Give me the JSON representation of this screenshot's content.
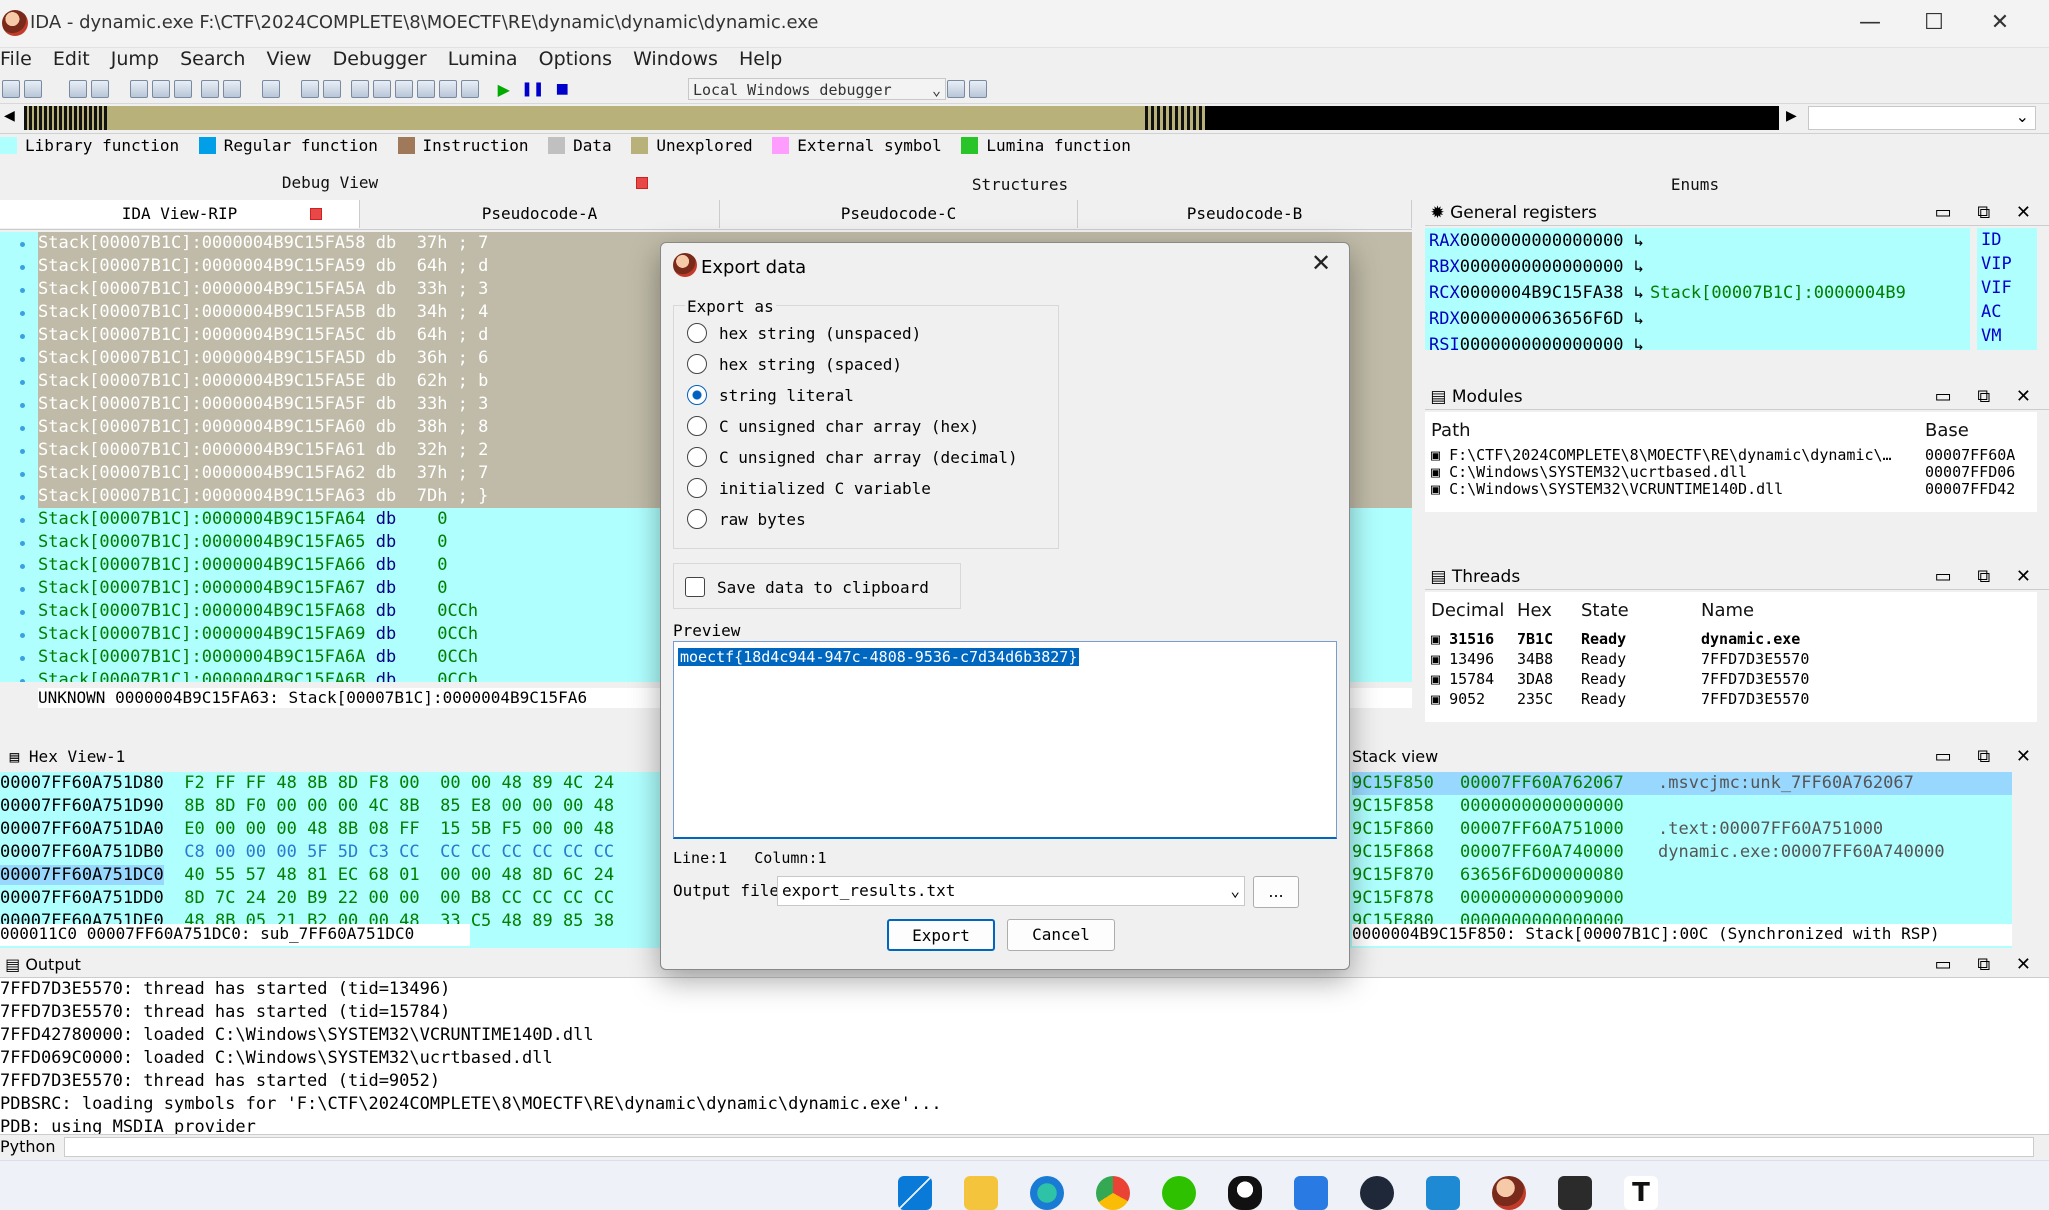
{
  "window": {
    "title": "IDA - dynamic.exe F:\\CTF\\2024COMPLETE\\8\\MOECTF\\RE\\dynamic\\dynamic\\dynamic.exe",
    "min": "—",
    "max": "☐",
    "close": "✕"
  },
  "menu": [
    "File",
    "Edit",
    "Jump",
    "Search",
    "View",
    "Debugger",
    "Lumina",
    "Options",
    "Windows",
    "Help"
  ],
  "toolbar": {
    "debugger": "Local Windows debugger"
  },
  "legend": [
    {
      "label": "Library function",
      "color": "#b0ffff"
    },
    {
      "label": "Regular function",
      "color": "#009fe8"
    },
    {
      "label": "Instruction",
      "color": "#a0785a"
    },
    {
      "label": "Data",
      "color": "#c0c0c0"
    },
    {
      "label": "Unexplored",
      "color": "#b8b27a"
    },
    {
      "label": "External symbol",
      "color": "#ff9cff"
    },
    {
      "label": "Lumina function",
      "color": "#28c428"
    }
  ],
  "panes": {
    "debug_view": "Debug View",
    "structures": "Structures",
    "enums": "Enums"
  },
  "tabs": [
    "IDA View-RIP",
    "Pseudocode-A",
    "Pseudocode-C",
    "Pseudocode-B"
  ],
  "disasm": [
    {
      "addr": "Stack[00007B1C]:0000004B9C15FA58",
      "op": "db",
      "arg": "37h ; 7",
      "gray": true
    },
    {
      "addr": "Stack[00007B1C]:0000004B9C15FA59",
      "op": "db",
      "arg": "64h ; d",
      "gray": true
    },
    {
      "addr": "Stack[00007B1C]:0000004B9C15FA5A",
      "op": "db",
      "arg": "33h ; 3",
      "gray": true
    },
    {
      "addr": "Stack[00007B1C]:0000004B9C15FA5B",
      "op": "db",
      "arg": "34h ; 4",
      "gray": true
    },
    {
      "addr": "Stack[00007B1C]:0000004B9C15FA5C",
      "op": "db",
      "arg": "64h ; d",
      "gray": true
    },
    {
      "addr": "Stack[00007B1C]:0000004B9C15FA5D",
      "op": "db",
      "arg": "36h ; 6",
      "gray": true
    },
    {
      "addr": "Stack[00007B1C]:0000004B9C15FA5E",
      "op": "db",
      "arg": "62h ; b",
      "gray": true
    },
    {
      "addr": "Stack[00007B1C]:0000004B9C15FA5F",
      "op": "db",
      "arg": "33h ; 3",
      "gray": true
    },
    {
      "addr": "Stack[00007B1C]:0000004B9C15FA60",
      "op": "db",
      "arg": "38h ; 8",
      "gray": true
    },
    {
      "addr": "Stack[00007B1C]:0000004B9C15FA61",
      "op": "db",
      "arg": "32h ; 2",
      "gray": true
    },
    {
      "addr": "Stack[00007B1C]:0000004B9C15FA62",
      "op": "db",
      "arg": "37h ; 7",
      "gray": true
    },
    {
      "addr": "Stack[00007B1C]:0000004B9C15FA63",
      "op": "db",
      "arg": "7Dh ; }",
      "gray": true
    },
    {
      "addr": "Stack[00007B1C]:0000004B9C15FA64",
      "op": "db",
      "arg": "0",
      "gray": false
    },
    {
      "addr": "Stack[00007B1C]:0000004B9C15FA65",
      "op": "db",
      "arg": "0",
      "gray": false
    },
    {
      "addr": "Stack[00007B1C]:0000004B9C15FA66",
      "op": "db",
      "arg": "0",
      "gray": false
    },
    {
      "addr": "Stack[00007B1C]:0000004B9C15FA67",
      "op": "db",
      "arg": "0",
      "gray": false
    },
    {
      "addr": "Stack[00007B1C]:0000004B9C15FA68",
      "op": "db",
      "arg": "0CCh",
      "gray": false
    },
    {
      "addr": "Stack[00007B1C]:0000004B9C15FA69",
      "op": "db",
      "arg": "0CCh",
      "gray": false
    },
    {
      "addr": "Stack[00007B1C]:0000004B9C15FA6A",
      "op": "db",
      "arg": "0CCh",
      "gray": false
    },
    {
      "addr": "Stack[00007B1C]:0000004B9C15FA6B",
      "op": "db",
      "arg": "0CCh",
      "gray": false
    }
  ],
  "disasm_status": "UNKNOWN 0000004B9C15FA63: Stack[00007B1C]:0000004B9C15FA6",
  "registers": {
    "title": "General registers",
    "rows": [
      {
        "name": "RAX",
        "val": "0000000000000000",
        "extra": ""
      },
      {
        "name": "RBX",
        "val": "0000000000000000",
        "extra": ""
      },
      {
        "name": "RCX",
        "val": "0000004B9C15FA38",
        "extra": "Stack[00007B1C]:0000004B9"
      },
      {
        "name": "RDX",
        "val": "0000000063656F6D",
        "extra": ""
      },
      {
        "name": "RSI",
        "val": "0000000000000000",
        "extra": ""
      }
    ],
    "flags": [
      "ID",
      "VIP",
      "VIF",
      "AC",
      "VM"
    ]
  },
  "modules": {
    "title": "Modules",
    "cols": [
      "Path",
      "Base"
    ],
    "rows": [
      {
        "path": "F:\\CTF\\2024COMPLETE\\8\\MOECTF\\RE\\dynamic\\dynamic\\…",
        "base": "00007FF60A"
      },
      {
        "path": "C:\\Windows\\SYSTEM32\\ucrtbased.dll",
        "base": "00007FFD06"
      },
      {
        "path": "C:\\Windows\\SYSTEM32\\VCRUNTIME140D.dll",
        "base": "00007FFD42"
      }
    ]
  },
  "threads": {
    "title": "Threads",
    "cols": [
      "Decimal",
      "Hex",
      "State",
      "Name"
    ],
    "rows": [
      {
        "dec": "31516",
        "hex": "7B1C",
        "state": "Ready",
        "name": "dynamic.exe"
      },
      {
        "dec": "13496",
        "hex": "34B8",
        "state": "Ready",
        "name": "7FFD7D3E5570"
      },
      {
        "dec": "15784",
        "hex": "3DA8",
        "state": "Ready",
        "name": "7FFD7D3E5570"
      },
      {
        "dec": "9052",
        "hex": "235C",
        "state": "Ready",
        "name": "7FFD7D3E5570"
      }
    ]
  },
  "hexview": {
    "title": "Hex View-1",
    "rows": [
      {
        "addr": "00007FF60A751D80",
        "bytes": "F2 FF FF 48 8B 8D F8 00  00 00 48 89 4C 24"
      },
      {
        "addr": "00007FF60A751D90",
        "bytes": "8B 8D F0 00 00 00 4C 8B  85 E8 00 00 00 48"
      },
      {
        "addr": "00007FF60A751DA0",
        "bytes": "E0 00 00 00 48 8B 08 FF  15 5B F5 00 00 48"
      },
      {
        "addr": "00007FF60A751DB0",
        "bytes": "C8 00 00 00 5F 5D C3 CC  CC CC CC CC CC CC"
      },
      {
        "addr": "00007FF60A751DC0",
        "bytes": "40 55 57 48 81 EC 68 01  00 00 48 8D 6C 24"
      },
      {
        "addr": "00007FF60A751DD0",
        "bytes": "8D 7C 24 20 B9 22 00 00  00 B8 CC CC CC CC"
      },
      {
        "addr": "00007FF60A751DE0",
        "bytes": "48 8B 05 21 B2 00 00 48  33 C5 48 89 85 38"
      }
    ],
    "status": "000011C0 00007FF60A751DC0: sub_7FF60A751DC0"
  },
  "stack": {
    "title": "Stack view",
    "rows": [
      {
        "addr": "9C15F850",
        "val": "00007FF60A762067",
        "cmt": ".msvcjmc:unk_7FF60A762067"
      },
      {
        "addr": "9C15F858",
        "val": "0000000000000000",
        "cmt": ""
      },
      {
        "addr": "9C15F860",
        "val": "00007FF60A751000",
        "cmt": ".text:00007FF60A751000"
      },
      {
        "addr": "9C15F868",
        "val": "00007FF60A740000",
        "cmt": "dynamic.exe:00007FF60A740000"
      },
      {
        "addr": "9C15F870",
        "val": "63656F6D00000080",
        "cmt": ""
      },
      {
        "addr": "9C15F878",
        "val": "0000000000009000",
        "cmt": ""
      },
      {
        "addr": "9C15F880",
        "val": "0000000000000000",
        "cmt": ""
      }
    ],
    "status": "0000004B9C15F850: Stack[00007B1C]:00C (Synchronized with RSP)"
  },
  "output": {
    "title": "Output",
    "lines": [
      "7FFD7D3E5570: thread has started (tid=13496)",
      "7FFD7D3E5570: thread has started (tid=15784)",
      "7FFD42780000: loaded C:\\Windows\\SYSTEM32\\VCRUNTIME140D.dll",
      "7FFD069C0000: loaded C:\\Windows\\SYSTEM32\\ucrtbased.dll",
      "7FFD7D3E5570: thread has started (tid=9052)",
      "PDBSRC: loading symbols for 'F:\\CTF\\2024COMPLETE\\8\\MOECTF\\RE\\dynamic\\dynamic\\dynamic.exe'...",
      "PDB: using MSDIA provider"
    ],
    "python": "Python"
  },
  "dialog": {
    "title": "Export data",
    "group": "Export as",
    "options": [
      "hex string (unspaced)",
      "hex string (spaced)",
      "string literal",
      "C unsigned char array (hex)",
      "C unsigned char array (decimal)",
      "initialized C variable",
      "raw bytes"
    ],
    "selected": 2,
    "clipboard": "Save data to clipboard",
    "preview_label": "Preview",
    "preview": "moectf{18d4c944-947c-4808-9536-c7d34d6b3827}",
    "cursor": "Line:1   Column:1",
    "output_label": "Output file",
    "output_file": "export_results.txt",
    "browse": "...",
    "ok": "Export",
    "cancel": "Cancel"
  }
}
